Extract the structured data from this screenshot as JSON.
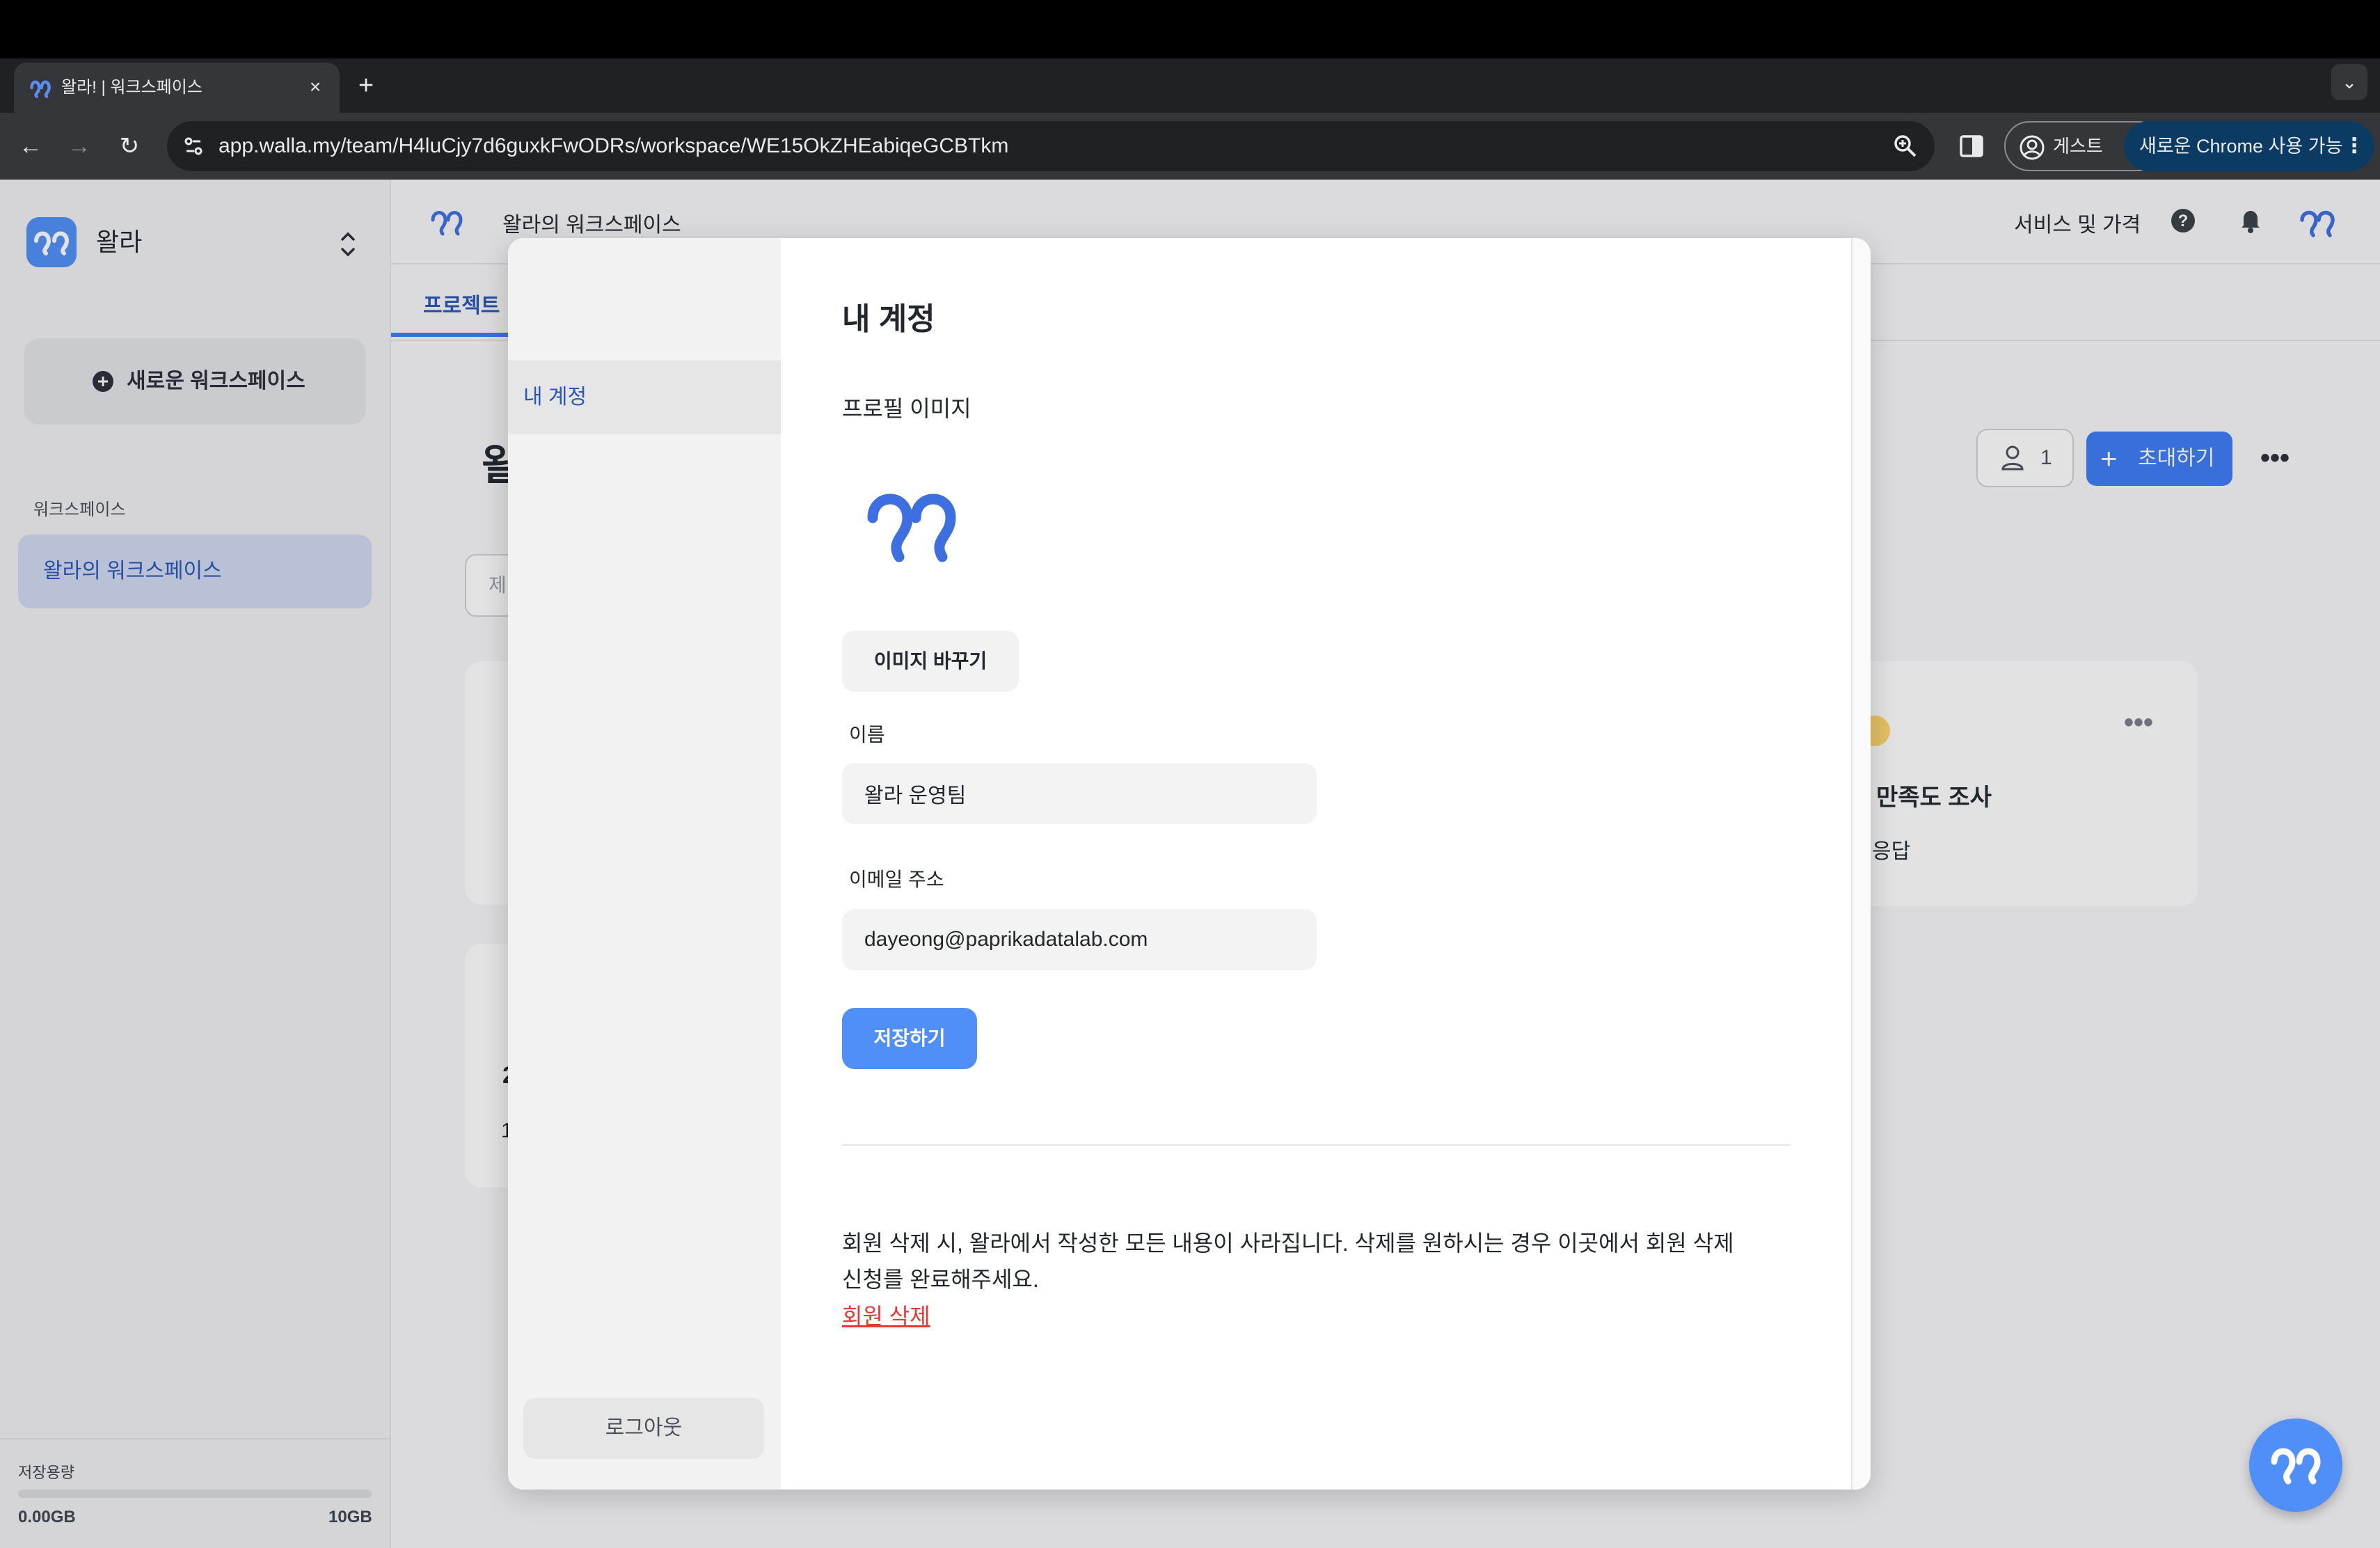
{
  "browser": {
    "tab_title": "왈라! | 워크스페이스",
    "url": "app.walla.my/team/H4luCjy7d6guxkFwODRs/workspace/WE15OkZHEabiqeGCBTkm",
    "guest_label": "게스트",
    "chrome_update_label": "새로운 Chrome 사용 가능"
  },
  "sidebar": {
    "app_name": "왈라",
    "new_workspace_label": "새로운 워크스페이스",
    "workspace_section_label": "워크스페이스",
    "workspace_item": "왈라의 워크스페이스",
    "storage_label": "저장용량",
    "storage_used": "0.00GB",
    "storage_total": "10GB",
    "storage_fraction": 0
  },
  "header": {
    "workspace_title": "왈라의 워크스페이스",
    "service_price": "서비스 및 가격"
  },
  "main": {
    "tab_projects": "프로젝트",
    "page_title_partial": "왈",
    "search_placeholder_partial": "제",
    "member_count": "1",
    "invite_label": "초대하기",
    "card3_title": "만족도 조사",
    "card3_sub": "응답",
    "card2_line1": "2",
    "card2_line2": "1"
  },
  "modal": {
    "nav_account": "내 계정",
    "logout": "로그아웃",
    "title": "내 계정",
    "profile_image_label": "프로필 이미지",
    "change_image": "이미지 바꾸기",
    "name_label": "이름",
    "name_value": "왈라 운영팀",
    "email_label": "이메일 주소",
    "email_value": "dayeong@paprikadatalab.com",
    "save": "저장하기",
    "warning_line1": "회원 삭제 시, 왈라에서 작성한 모든 내용이 사라집니다. 삭제를 원하시는 경우 이곳에서 회원 삭제",
    "warning_line2": "신청를 완료해주세요.",
    "delete_link": "회원 삭제"
  },
  "colors": {
    "brand": "#4f8ff7",
    "primary_button": "#3d7bf5",
    "link": "#2a56b5",
    "danger": "#e53935"
  }
}
